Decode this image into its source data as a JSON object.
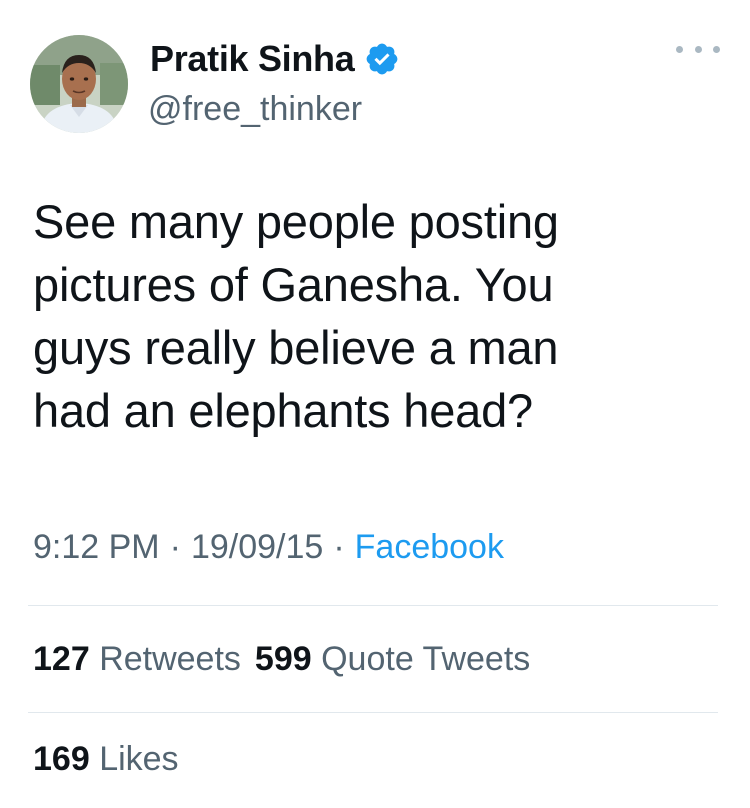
{
  "author": {
    "display_name": "Pratik Sinha",
    "handle": "@free_thinker",
    "verified": true
  },
  "tweet": {
    "text_lines": [
      "See many people posting",
      "pictures of Ganesha. You",
      "guys really believe a man",
      "had an elephants head?"
    ],
    "time": "9:12 PM",
    "date": "19/09/15",
    "separator": "·",
    "source": "Facebook"
  },
  "stats": {
    "retweets_count": "127",
    "retweets_label": "Retweets",
    "quote_count": "599",
    "quote_label": "Quote Tweets",
    "likes_count": "169",
    "likes_label": "Likes"
  },
  "icons": {
    "verified": "verified-badge-icon",
    "more": "more-options-icon"
  },
  "colors": {
    "text": "#0f1419",
    "secondary": "#536471",
    "accent": "#1d9bf0",
    "divider": "#e1e8ed"
  }
}
